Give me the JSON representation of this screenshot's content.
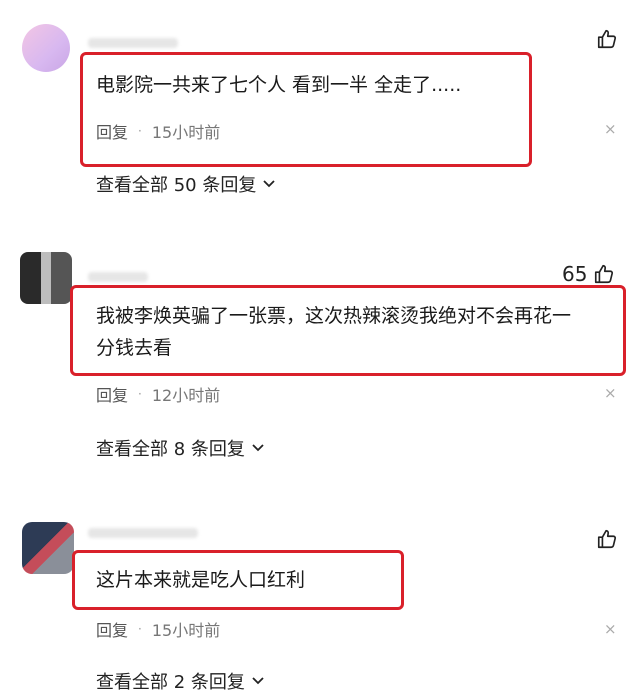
{
  "comments": [
    {
      "text": "电影院一共来了七个人 看到一半 全走了.....",
      "reply": "回复",
      "dot": "·",
      "time": "15小时前",
      "close": "×",
      "likes": "",
      "replies_label": "查看全部 50 条回复"
    },
    {
      "text_line1": "我被李焕英骗了一张票，这次热辣滚烫我绝对不会再花一",
      "text_line2": "分钱去看",
      "reply": "回复",
      "dot": "·",
      "time": "12小时前",
      "close": "×",
      "likes": "65",
      "replies_label": "查看全部 8 条回复"
    },
    {
      "text": "这片本来就是吃人口红利",
      "reply": "回复",
      "dot": "·",
      "time": "15小时前",
      "close": "×",
      "likes": "",
      "replies_label": "查看全部 2 条回复"
    }
  ],
  "colors": {
    "highlight_border": "#d9202a",
    "meta_text": "#777777"
  },
  "icons": {
    "like": "thumbs-up-icon",
    "expand": "chevron-down-icon",
    "close": "close-icon"
  }
}
